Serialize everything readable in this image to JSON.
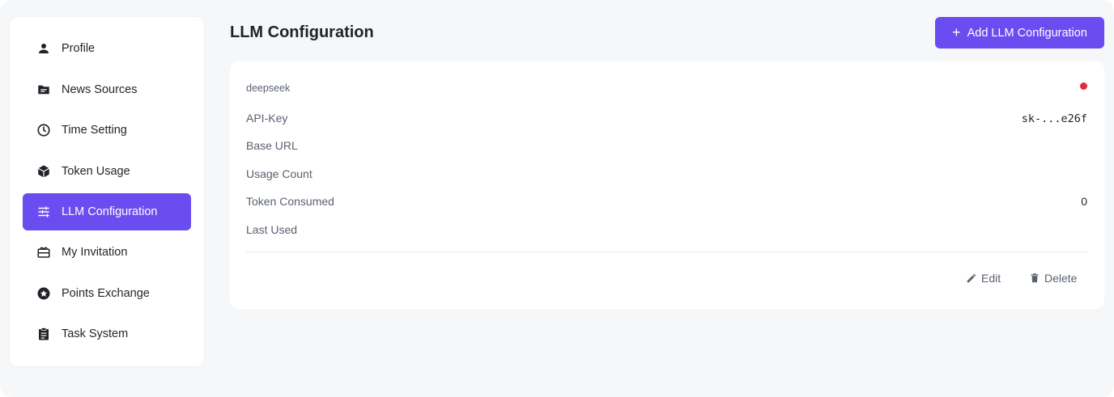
{
  "sidebar": {
    "items": [
      {
        "label": "Profile",
        "icon": "person-icon",
        "active": false
      },
      {
        "label": "News Sources",
        "icon": "folder-icon",
        "active": false
      },
      {
        "label": "Time Setting",
        "icon": "clock-icon",
        "active": false
      },
      {
        "label": "Token Usage",
        "icon": "cube-icon",
        "active": false
      },
      {
        "label": "LLM Configuration",
        "icon": "sliders-icon",
        "active": true
      },
      {
        "label": "My Invitation",
        "icon": "gift-card-icon",
        "active": false
      },
      {
        "label": "Points Exchange",
        "icon": "star-badge-icon",
        "active": false
      },
      {
        "label": "Task System",
        "icon": "clipboard-icon",
        "active": false
      }
    ]
  },
  "header": {
    "title": "LLM Configuration",
    "add_button_label": "Add LLM Configuration",
    "add_button_icon": "plus-icon"
  },
  "config_card": {
    "provider": "deepseek",
    "status_color": "#e02b3a",
    "rows": [
      {
        "label": "API-Key",
        "value": "sk-...e26f"
      },
      {
        "label": "Base URL",
        "value": ""
      },
      {
        "label": "Usage Count",
        "value": ""
      },
      {
        "label": "Token Consumed",
        "value": "0"
      },
      {
        "label": "Last Used",
        "value": ""
      }
    ],
    "edit_label": "Edit",
    "delete_label": "Delete"
  },
  "colors": {
    "accent": "#6a4df0",
    "background": "#f6f7f9",
    "status_dot": "#e02b3a"
  }
}
